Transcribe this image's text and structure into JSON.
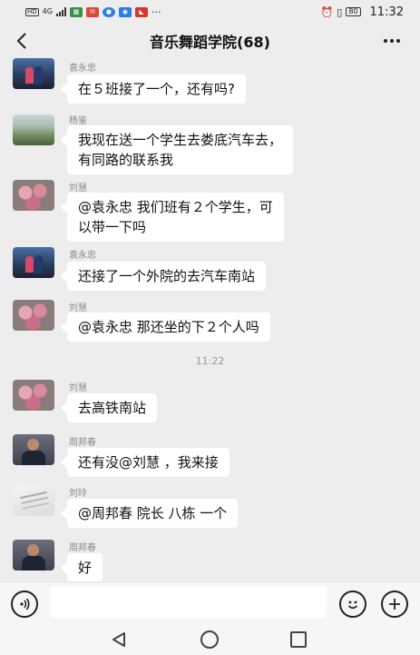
{
  "status_bar": {
    "hd_label": "HD",
    "network_label": "4G",
    "battery_label": "80",
    "time": "11:32"
  },
  "header": {
    "title": "音乐舞蹈学院(68)",
    "back_icon": "chevron-left-icon",
    "more_icon": "more-dots-icon"
  },
  "messages": [
    {
      "sender": "袁永忠",
      "text": "在５班接了一个，还有吗?"
    },
    {
      "sender": "杨鉴",
      "text": "我现在送一个学生去娄底汽车去，\n有同路的联系我"
    },
    {
      "sender": "刘慧",
      "text": "@袁永忠  我们班有２个学生，可\n以带一下吗"
    },
    {
      "sender": "袁永忠",
      "text": "还接了一个外院的去汽车南站"
    },
    {
      "sender": "刘慧",
      "text": "@袁永忠  那还坐的下２个人吗"
    },
    {
      "sender": "刘慧",
      "text": "去高铁南站"
    },
    {
      "sender": "周邦春",
      "text": "还有没@刘慧 ，我来接"
    },
    {
      "sender": "刘玲",
      "text": "@周邦春  院长 八栋 一个"
    },
    {
      "sender": "周邦春",
      "text": "好"
    }
  ],
  "timestamp": "11:22",
  "composer": {
    "voice_icon": "voice-icon",
    "emoji_icon": "emoji-icon",
    "plus_icon": "plus-icon",
    "input_value": ""
  },
  "navbar": {
    "back_icon": "triangle-back-icon",
    "home_icon": "circle-home-icon",
    "recent_icon": "square-recents-icon"
  }
}
